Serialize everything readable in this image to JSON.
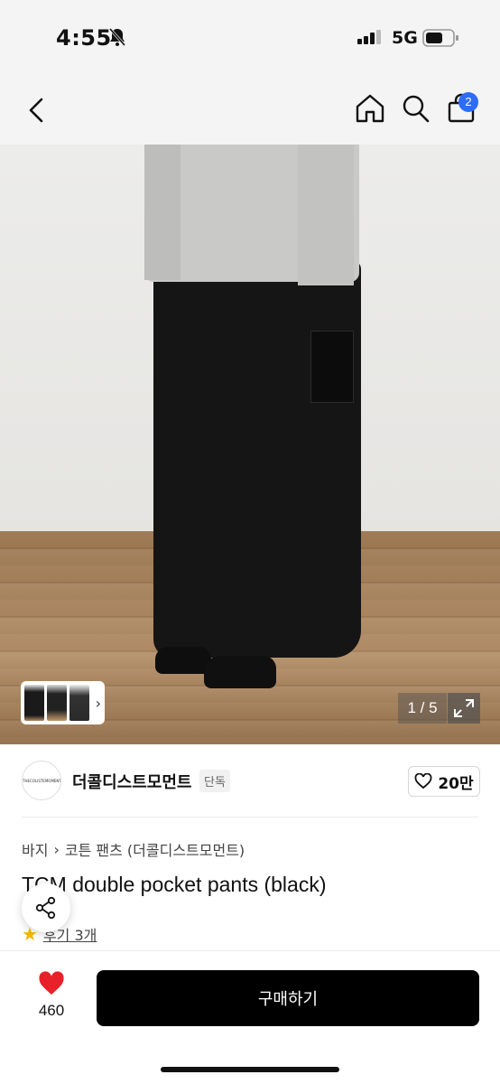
{
  "status_bar": {
    "time": "4:55",
    "network": "5G"
  },
  "nav": {
    "cart_count": "2",
    "icons": [
      "back-icon",
      "home-icon",
      "search-icon",
      "shopping-bag-icon"
    ]
  },
  "gallery": {
    "counter": "1 / 5",
    "thumb_arrow": "›"
  },
  "brand": {
    "logo_text": "THECOLISTEMOMENT",
    "name": "더콜디스트모먼트",
    "tag": "단독",
    "likes": "20만"
  },
  "product": {
    "breadcrumb": [
      "바지",
      "코튼 팬츠 (더콜디스트모먼트)"
    ],
    "breadcrumb_sep": "›",
    "title": "TCM double pocket pants (black)",
    "rating_star": "★",
    "review_link": "후기 3개"
  },
  "bottom_bar": {
    "wish_count": "460",
    "buy_label": "구매하기"
  },
  "colors": {
    "accent": "#2f6cf6",
    "heart": "#e8202a",
    "star": "#f5b700",
    "buy_bg": "#000000"
  }
}
